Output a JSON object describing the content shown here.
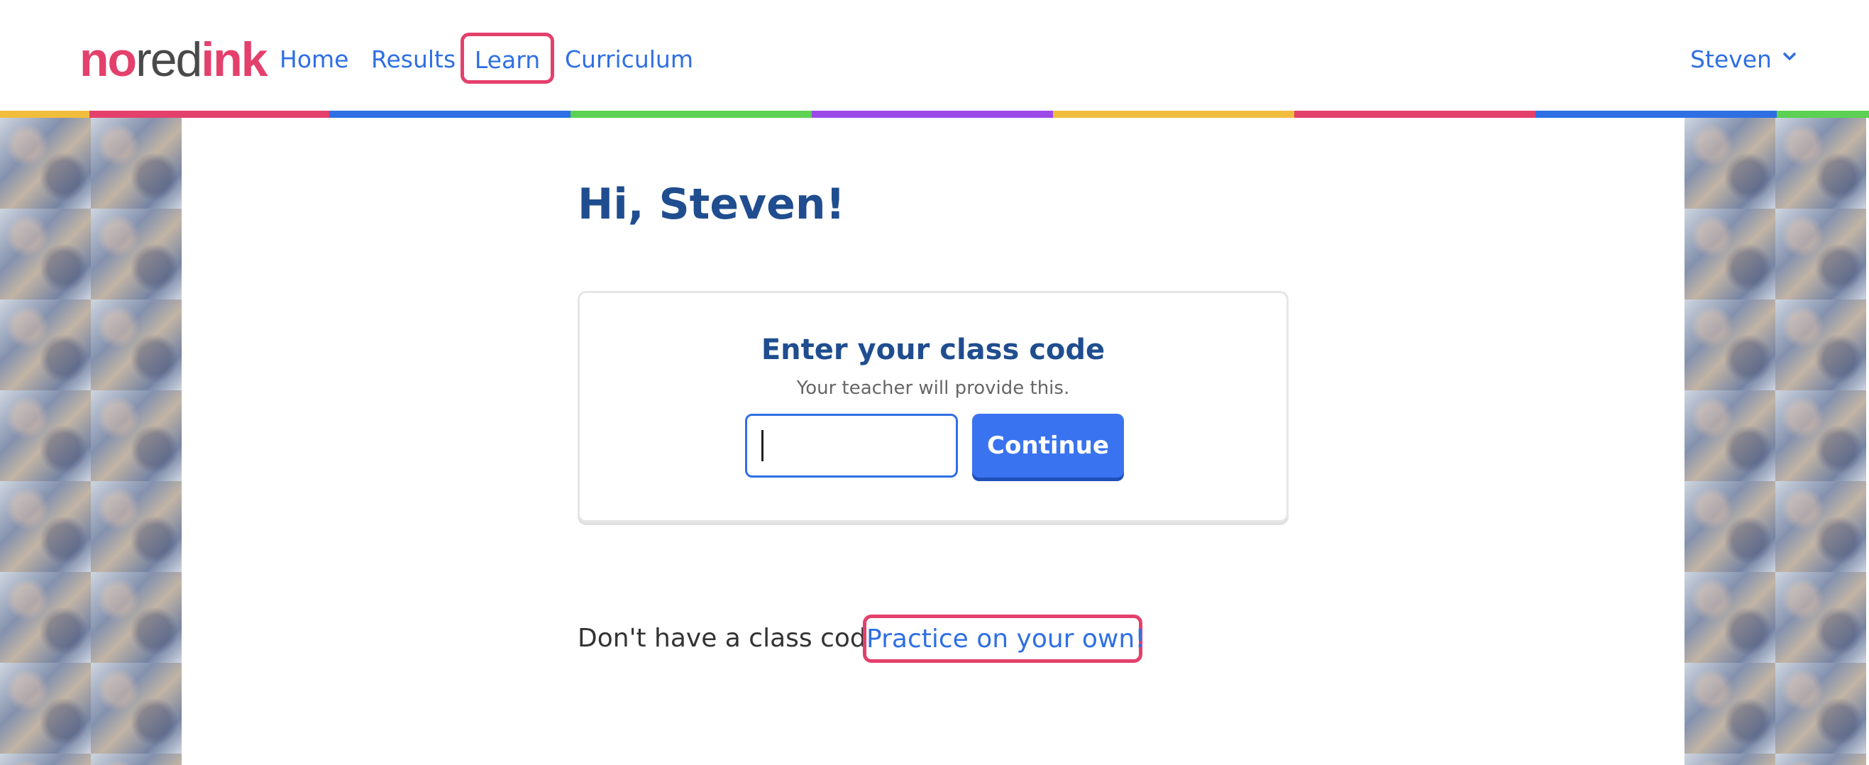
{
  "header": {
    "logo": {
      "part1": "no",
      "part2": "red",
      "part3": "ink"
    },
    "nav": {
      "home": "Home",
      "results": "Results",
      "learn": "Learn",
      "curriculum": "Curriculum"
    },
    "user_menu": {
      "label": "Steven",
      "icon": "chevron-down-icon"
    }
  },
  "stripe_colors": [
    "#f0be3c",
    "#e4406c",
    "#2f6fe4",
    "#5cd153",
    "#9b4ae8",
    "#f0be3c",
    "#e4406c",
    "#2f6fe4",
    "#5cd153"
  ],
  "main": {
    "greeting": "Hi, Steven!",
    "class_code_card": {
      "title": "Enter your class code",
      "subtitle": "Your teacher will provide this.",
      "input_value": "",
      "button_label": "Continue"
    },
    "no_code": {
      "text": "Don't have a class code?",
      "link": "Practice on your own!"
    }
  },
  "colors": {
    "brand_pink": "#e4406c",
    "link_blue": "#2f6fe4",
    "heading_navy": "#1f4d8f",
    "button_blue": "#3a73f0"
  }
}
